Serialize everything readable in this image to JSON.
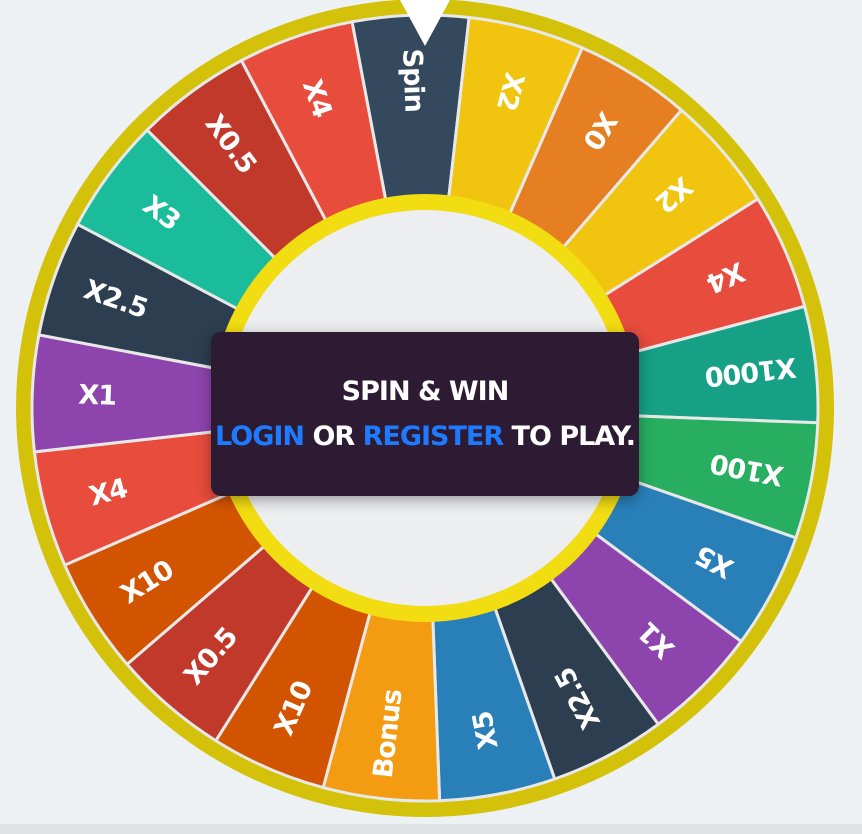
{
  "wheel": {
    "segments": [
      {
        "label": "Spin",
        "color": "#34495e"
      },
      {
        "label": "X2",
        "color": "#f1c40f"
      },
      {
        "label": "X0",
        "color": "#e67e22"
      },
      {
        "label": "X2",
        "color": "#f1c40f"
      },
      {
        "label": "X4",
        "color": "#e74c3c"
      },
      {
        "label": "X1000",
        "color": "#16a085"
      },
      {
        "label": "X100",
        "color": "#27ae60"
      },
      {
        "label": "X5",
        "color": "#2980b9"
      },
      {
        "label": "X1",
        "color": "#8e44ad"
      },
      {
        "label": "X2.5",
        "color": "#2c3e50"
      },
      {
        "label": "X5",
        "color": "#2980b9"
      },
      {
        "label": "Bonus",
        "color": "#f39c12"
      },
      {
        "label": "X10",
        "color": "#d35400"
      },
      {
        "label": "X0.5",
        "color": "#c0392b"
      },
      {
        "label": "X10",
        "color": "#d35400"
      },
      {
        "label": "X4",
        "color": "#e74c3c"
      },
      {
        "label": "X1",
        "color": "#8e44ad"
      },
      {
        "label": "X2.5",
        "color": "#2c3e50"
      },
      {
        "label": "X3",
        "color": "#1abc9c"
      },
      {
        "label": "X0.5",
        "color": "#c0392b"
      },
      {
        "label": "X4",
        "color": "#e74c3c"
      }
    ],
    "rim_color": "#d4c20a",
    "inner_ring_color": "#f2dc12",
    "hub_color": "#eceeef",
    "pointer_color": "#ffffff"
  },
  "panel": {
    "title": "SPIN & WIN",
    "login_label": "LOGIN",
    "or_text": "OR",
    "register_label": "REGISTER",
    "to_play_text": "TO PLAY.",
    "link_color": "#1e7bff"
  }
}
